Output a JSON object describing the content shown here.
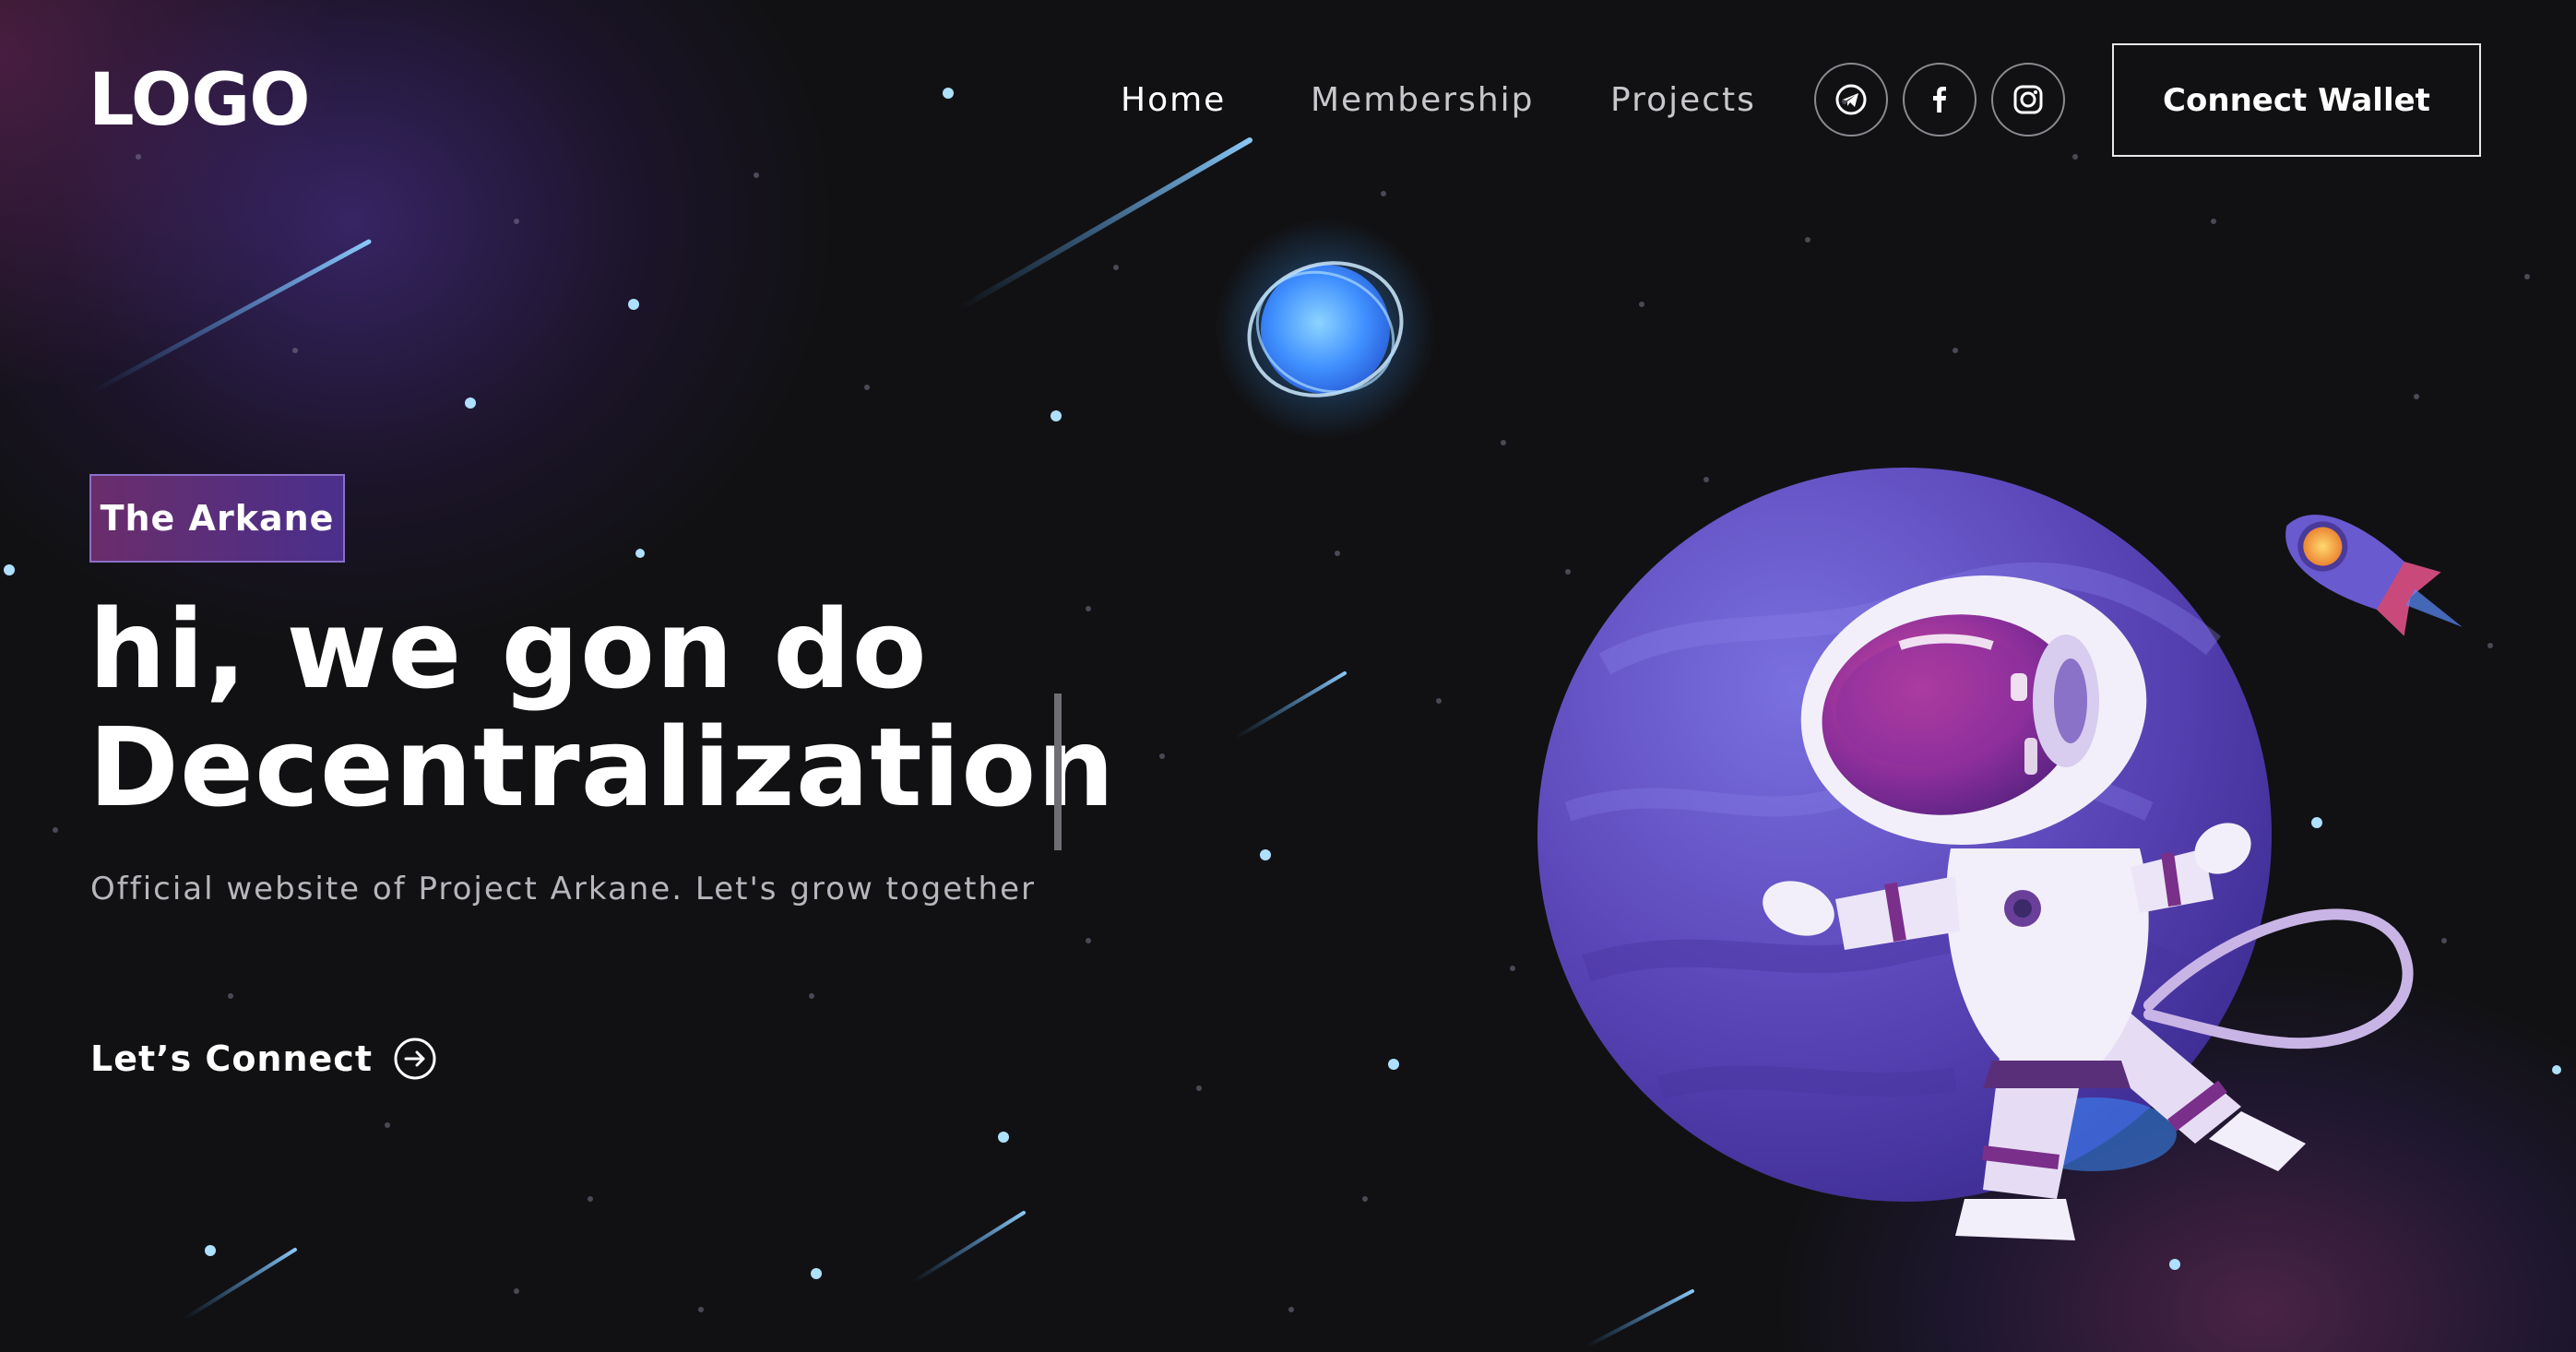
{
  "logo": {
    "text": "LOGO"
  },
  "nav": {
    "items": [
      {
        "label": "Home",
        "active": true
      },
      {
        "label": "Membership",
        "active": false
      },
      {
        "label": "Projects",
        "active": false
      }
    ],
    "social": [
      {
        "icon": "telegram-icon"
      },
      {
        "icon": "facebook-icon"
      },
      {
        "icon": "instagram-icon"
      }
    ],
    "wallet_button": "Connect Wallet"
  },
  "hero": {
    "tag": "The Arkane",
    "headline_line1": "hi, we gon do",
    "headline_line2": "Decentralization",
    "subtitle": "Official website of Project Arkane. Let's grow together",
    "cta": "Let’s Connect",
    "cta_icon": "arrow-right-circle-icon"
  },
  "illustration": {
    "elements": [
      "glowing-orb",
      "purple-planet",
      "astronaut",
      "rocket",
      "shooting-stars"
    ]
  },
  "colors": {
    "background": "#111113",
    "accent_purple": "#5b46b8",
    "tag_gradient_start": "#6a2d6a",
    "tag_gradient_end": "#4a2f8c",
    "text": "#ffffff",
    "muted_text": "#b6b6bc"
  }
}
